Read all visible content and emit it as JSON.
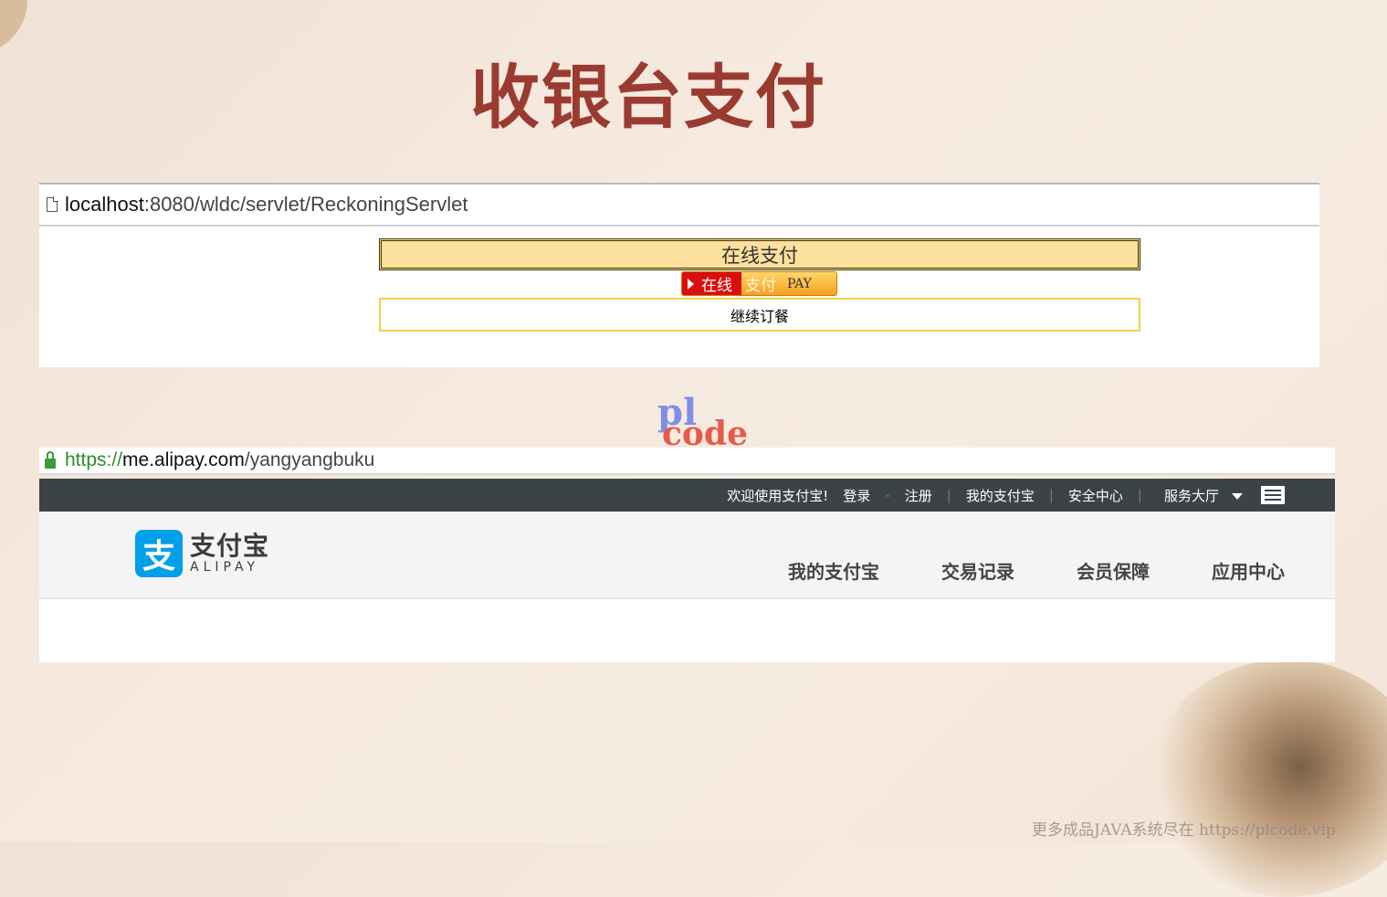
{
  "slide": {
    "title": "收银台支付",
    "footer_watermark": "更多成品JAVA系统尽在 https://plcode.vip"
  },
  "watermark": {
    "top": "pl",
    "bottom": "code"
  },
  "screenshot1": {
    "url_host": "localhost",
    "url_path": ":8080/wldc/servlet/ReckoningServlet",
    "page_icon": "page-icon",
    "header_label": "在线支付",
    "pay_button": {
      "left": "在线",
      "mid": "支付",
      "right": "PAY"
    },
    "continue_button": "继续订餐"
  },
  "screenshot2": {
    "url_scheme": "https://",
    "url_host": "me.alipay.com",
    "url_path": "/yangyangbuku",
    "lock_icon": "lock-icon",
    "topbar": {
      "welcome": "欢迎使用支付宝!",
      "login": "登录",
      "register": "注册",
      "my_alipay": "我的支付宝",
      "security": "安全中心",
      "service": "服务大厅"
    },
    "logo": {
      "cn": "支付宝",
      "en": "ALIPAY",
      "mark": "支"
    },
    "nav": [
      "我的支付宝",
      "交易记录",
      "会员保障",
      "应用中心"
    ]
  },
  "colors": {
    "title": "#9a3b32",
    "pay_header_bg": "#fde09d",
    "alipay_blue": "#00a0e9",
    "topbar_bg": "#3c4346"
  }
}
